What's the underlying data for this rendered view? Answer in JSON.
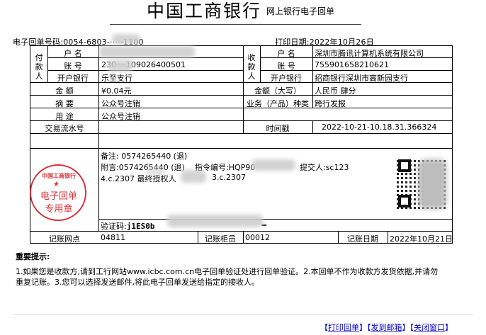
{
  "header": {
    "bank_name": "中国工商银行",
    "doc_title": "网上银行电子回单"
  },
  "meta": {
    "receipt_no_label": "电子回单号码:",
    "receipt_no_value": "0054-6803-····-1100",
    "print_date_label": "打印日期:",
    "print_date_value": "2022年10月26日"
  },
  "payer": {
    "section_label": "付款人",
    "name_label": "户  名",
    "name_value": "",
    "account_label": "账  号",
    "account_value": "230····109026400501",
    "bank_label": "开户银行",
    "bank_value": "乐至支行"
  },
  "payee": {
    "section_label": "收款人",
    "name_label": "户  名",
    "name_value": "深圳市腾讯计算机系统有限公司",
    "account_label": "账  号",
    "account_value": "755901658210621",
    "bank_label": "开户银行",
    "bank_value": "招商银行深圳市高新园支行"
  },
  "amount": {
    "label": "金  额",
    "value": "¥0.04元",
    "upper_label": "金额（大写）",
    "upper_value": "人民币 肆分"
  },
  "summary": {
    "label": "摘  要",
    "value": "公众号注销",
    "business_label": "业务（产品）种类",
    "business_value": "跨行发报"
  },
  "purpose": {
    "label": "用  途",
    "value": "公众号注销"
  },
  "transaction": {
    "serial_label": "交易流水号",
    "serial_value": "",
    "timestamp_label": "时间戳",
    "timestamp_value": "2022-10-21-10.18.31.366324"
  },
  "remarks": {
    "line1": "备注: 0574265440 (退)",
    "line2a": "附言:0574265440 (退)",
    "line2b": "指令编号:HQP90",
    "line2c": "提交人:sc123",
    "line3a": "4.c.2307 最终授权人",
    "line3b": "3.c.2307",
    "verify_label": "验证码:",
    "verify_value": "j1ES0b",
    "verify_tail": "="
  },
  "seal": {
    "top_text": "中国工商银行",
    "line1": "电子回单",
    "line2": "专用章"
  },
  "footer_row": {
    "branch_label": "记账网点",
    "branch_value": "04811",
    "teller_label": "记账柜员",
    "teller_value": "00012",
    "date_label": "记账日期",
    "date_value": "2022年10月21日"
  },
  "notice": {
    "title": "重要提示:",
    "line1": "1.如果您是收款方,请到工行网站www.icbc.com.cn电子回单验证处进行回单验证。2.本回单不作为收款方发货依据,并请勿",
    "line2": "重复记账。3.您可以选择发送邮件,将此电子回单发送给指定的接收人。"
  },
  "actions": {
    "print": "打印回单",
    "send": "发到邮箱",
    "close": "关闭窗口"
  }
}
